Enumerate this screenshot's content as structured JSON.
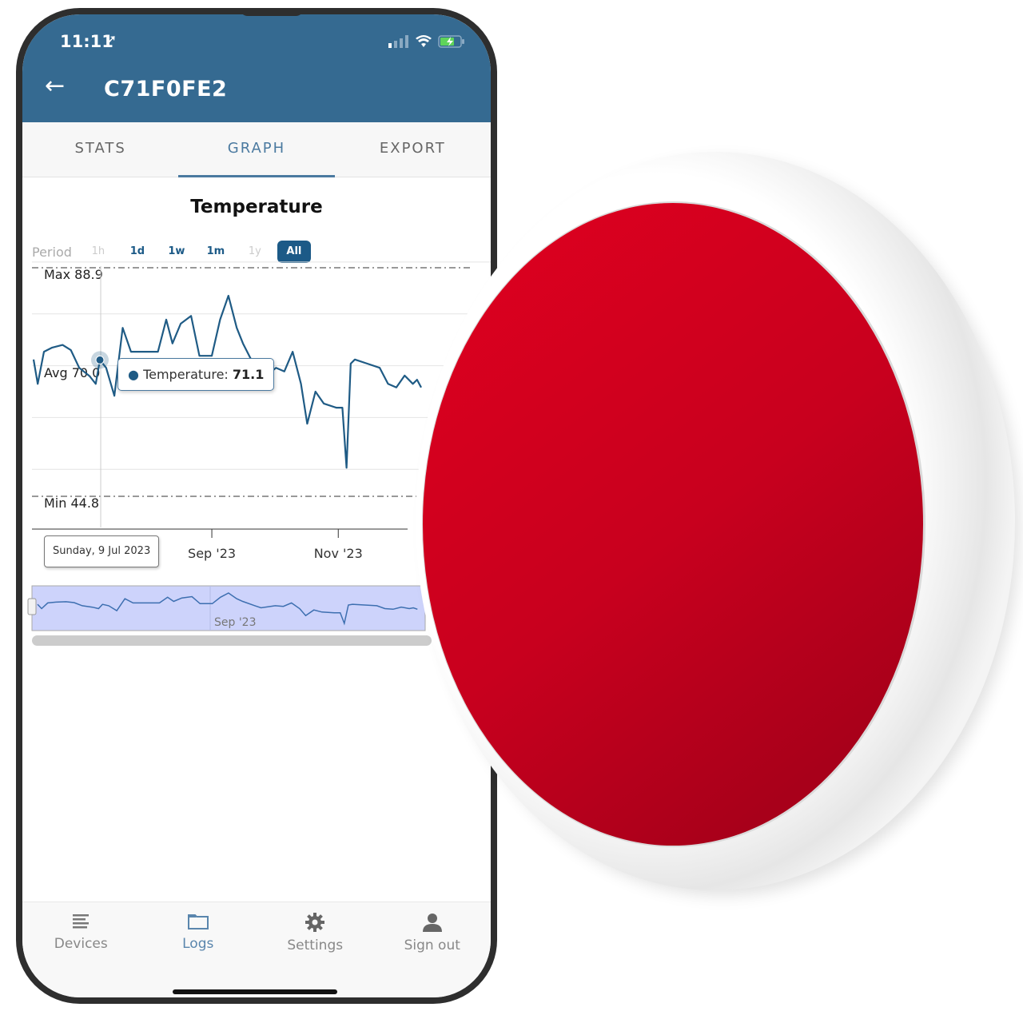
{
  "status_bar": {
    "time": "11:11",
    "location_icon": "location-arrow-icon",
    "signal_icon": "cellular-signal-icon",
    "wifi_icon": "wifi-icon",
    "battery_icon": "battery-charging-icon"
  },
  "header": {
    "back_icon": "arrow-left-icon",
    "title": "C71F0FE2",
    "color": "#356a91"
  },
  "tabs": [
    {
      "label": "STATS",
      "active": false
    },
    {
      "label": "GRAPH",
      "active": true
    },
    {
      "label": "EXPORT",
      "active": false
    }
  ],
  "graph": {
    "title": "Temperature",
    "period_label": "Period",
    "periods": [
      {
        "label": "1h",
        "state": "disabled"
      },
      {
        "label": "1d",
        "state": "enabled"
      },
      {
        "label": "1w",
        "state": "enabled"
      },
      {
        "label": "1m",
        "state": "enabled"
      },
      {
        "label": "1y",
        "state": "disabled"
      },
      {
        "label": "All",
        "state": "selected"
      }
    ],
    "tooltip": {
      "series": "Temperature: ",
      "value": "71.1"
    },
    "date_tooltip": "Sunday, 9 Jul 2023",
    "navigator_label": "Sep '23"
  },
  "chart_data": {
    "type": "line",
    "title": "Temperature",
    "series": [
      {
        "name": "Temperature",
        "color": "#1f5b85",
        "x": [
          "2023-06-07",
          "2023-06-09",
          "2023-06-12",
          "2023-06-16",
          "2023-06-21",
          "2023-06-25",
          "2023-06-29",
          "2023-07-04",
          "2023-07-07",
          "2023-07-09",
          "2023-07-12",
          "2023-07-16",
          "2023-07-20",
          "2023-07-24",
          "2023-07-30",
          "2023-08-06",
          "2023-08-10",
          "2023-08-13",
          "2023-08-17",
          "2023-08-22",
          "2023-08-26",
          "2023-09-01",
          "2023-09-05",
          "2023-09-09",
          "2023-09-13",
          "2023-09-16",
          "2023-09-22",
          "2023-09-25",
          "2023-10-02",
          "2023-10-06",
          "2023-10-10",
          "2023-10-14",
          "2023-10-17",
          "2023-10-21",
          "2023-10-25",
          "2023-10-31",
          "2023-11-03",
          "2023-11-05",
          "2023-11-07",
          "2023-11-09",
          "2023-11-15",
          "2023-11-21",
          "2023-11-25",
          "2023-11-29",
          "2023-12-03",
          "2023-12-07",
          "2023-12-09",
          "2023-12-11"
        ],
        "values": [
          71.2,
          66.5,
          72.7,
          73.5,
          74.0,
          73.0,
          69.6,
          68.0,
          66.5,
          71.1,
          69.6,
          64.2,
          77.3,
          72.7,
          72.7,
          72.7,
          78.9,
          74.3,
          78.1,
          79.6,
          71.9,
          71.9,
          78.9,
          83.5,
          77.3,
          74.3,
          69.6,
          67.3,
          69.6,
          68.9,
          72.7,
          66.5,
          58.8,
          65.0,
          62.7,
          61.9,
          61.9,
          50.3,
          70.4,
          71.2,
          70.4,
          69.6,
          66.5,
          65.8,
          68.1,
          66.5,
          67.3,
          65.8
        ]
      }
    ],
    "plot_lines": [
      {
        "label": "Max 88.9",
        "value": 88.9
      },
      {
        "label": "Avg 70.0",
        "value": 70.0
      },
      {
        "label": "Min 44.8",
        "value": 44.8
      }
    ],
    "x_ticks": [
      "Sep '23",
      "Nov '23"
    ],
    "x_tick_dates": [
      "2023-09-01",
      "2023-11-01"
    ],
    "xlim": [
      "2023-06-07",
      "2023-12-11"
    ],
    "ylim": [
      39.9,
      90
    ],
    "y_gridlines": [
      50,
      60,
      70,
      80,
      90
    ],
    "grid": true,
    "highlight": {
      "x": "2023-07-09",
      "value": 71.1
    }
  },
  "bottom_nav": [
    {
      "label": "Devices",
      "icon": "list-icon",
      "active": false
    },
    {
      "label": "Logs",
      "icon": "folder-icon",
      "active": true
    },
    {
      "label": "Settings",
      "icon": "gear-icon",
      "active": false
    },
    {
      "label": "Sign out",
      "icon": "user-icon",
      "active": false
    }
  ],
  "product": {
    "name": "red-disc-sensor",
    "color": "#d0001e"
  }
}
